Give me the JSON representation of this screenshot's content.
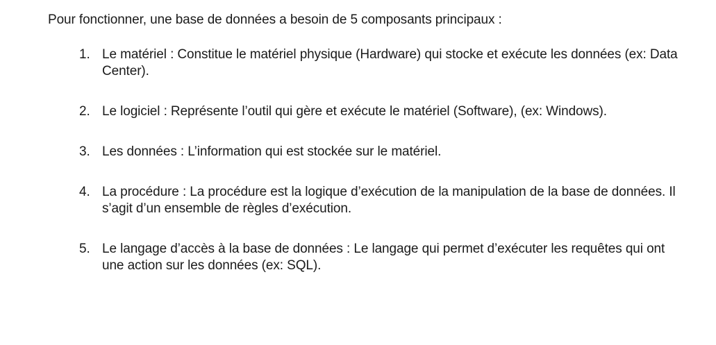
{
  "intro": "Pour fonctionner, une base de données a besoin de 5 composants principaux :",
  "items": [
    {
      "number": "1.",
      "text": "Le matériel : Constitue le matériel physique (Hardware) qui stocke et exécute les données (ex: Data Center)."
    },
    {
      "number": "2.",
      "text": "Le logiciel : Représente l’outil qui gère et exécute le matériel (Software), (ex: Windows)."
    },
    {
      "number": "3.",
      "text": "Les données : L’information qui est stockée sur le matériel."
    },
    {
      "number": "4.",
      "text": "La procédure : La procédure est la logique d’exécution de la manipulation de la base de données. Il s’agit d’un ensemble de règles d’exécution."
    },
    {
      "number": "5.",
      "text": "Le langage d’accès à la base de données : Le langage qui permet d’exécuter les requêtes qui ont une action sur les données (ex: SQL)."
    }
  ]
}
